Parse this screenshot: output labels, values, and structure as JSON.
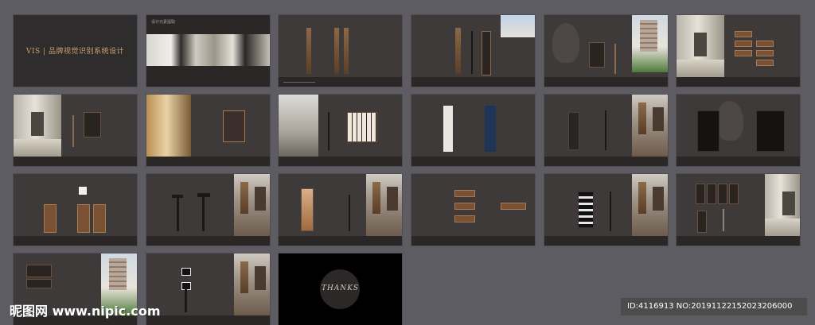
{
  "cover": {
    "title": "VIS | 品牌视觉识别系统设计"
  },
  "slide2": {
    "caption": "设计元素提取"
  },
  "thanks": {
    "text": "THANKS"
  },
  "watermark": {
    "logo_text": "昵图网 www.nipic.com",
    "id_text": "ID:4116913 NO:20191122152023206000"
  },
  "colors": {
    "page_bg": "#5e5c63",
    "slide_bg": "#3e3a3a",
    "gold_text": "#c9a36c"
  }
}
